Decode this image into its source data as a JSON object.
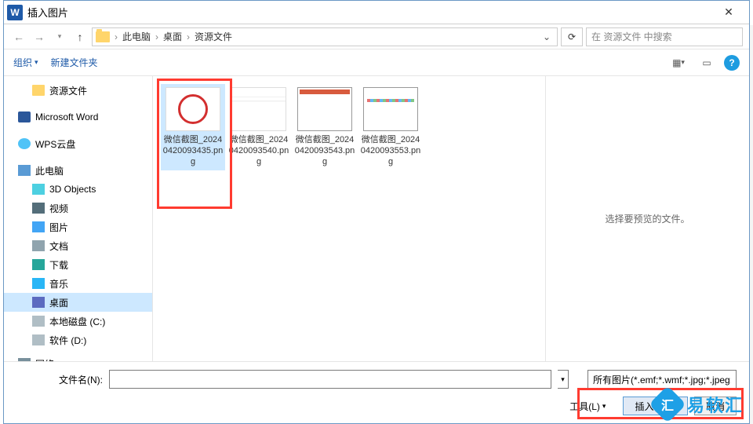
{
  "title": "插入图片",
  "breadcrumb": {
    "root_sep": "›",
    "parts": [
      "此电脑",
      "桌面",
      "资源文件"
    ]
  },
  "search": {
    "placeholder": "在 资源文件 中搜索"
  },
  "toolbar": {
    "organize": "组织",
    "new_folder": "新建文件夹"
  },
  "sidebar": {
    "items": [
      {
        "label": "资源文件",
        "icon": "folder",
        "level": 1
      },
      {
        "label": "Microsoft Word",
        "icon": "word",
        "level": 0
      },
      {
        "label": "WPS云盘",
        "icon": "cloud",
        "level": 0
      },
      {
        "label": "此电脑",
        "icon": "pc",
        "level": 0
      },
      {
        "label": "3D Objects",
        "icon": "obj",
        "level": 1
      },
      {
        "label": "视频",
        "icon": "vid",
        "level": 1
      },
      {
        "label": "图片",
        "icon": "img",
        "level": 1
      },
      {
        "label": "文档",
        "icon": "doc",
        "level": 1
      },
      {
        "label": "下载",
        "icon": "dl",
        "level": 1
      },
      {
        "label": "音乐",
        "icon": "music",
        "level": 1
      },
      {
        "label": "桌面",
        "icon": "desk",
        "level": 1,
        "selected": true
      },
      {
        "label": "本地磁盘 (C:)",
        "icon": "disk",
        "level": 1
      },
      {
        "label": "软件 (D:)",
        "icon": "disk",
        "level": 1
      },
      {
        "label": "网络",
        "icon": "net",
        "level": 0
      }
    ]
  },
  "files": [
    {
      "name": "微信截图_20240420093435.png",
      "thumb": "stamp",
      "selected": true
    },
    {
      "name": "微信截图_20240420093540.png",
      "thumb": "docprev"
    },
    {
      "name": "微信截图_20240420093543.png",
      "thumb": "app1"
    },
    {
      "name": "微信截图_20240420093553.png",
      "thumb": "app2"
    }
  ],
  "preview": {
    "empty_text": "选择要预览的文件。"
  },
  "footer": {
    "filename_label": "文件名(N):",
    "filename_value": "",
    "filter_label": "所有图片(*.emf;*.wmf;*.jpg;*.jpeg;*.png;*.bmp;*.gif;*.tif;*.tiff)",
    "tools_label": "工具(L)",
    "insert_label": "插入(S)",
    "cancel_label": "取消"
  },
  "watermark": "易软汇"
}
